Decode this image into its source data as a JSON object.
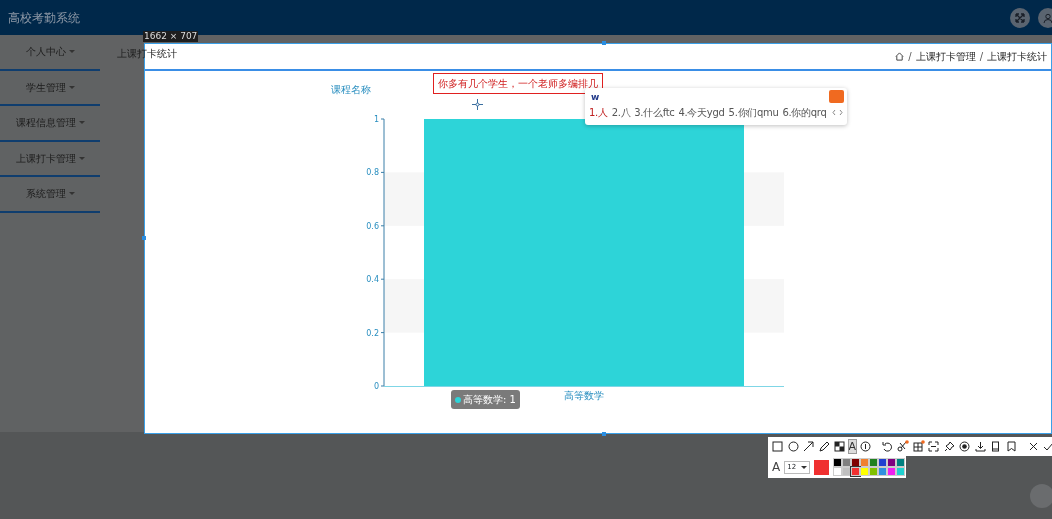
{
  "app": {
    "title": "高校考勤系统"
  },
  "sidebar": {
    "items": [
      {
        "label": "个人中心"
      },
      {
        "label": "学生管理"
      },
      {
        "label": "课程信息管理"
      },
      {
        "label": "上课打卡管理"
      },
      {
        "label": "系统管理"
      }
    ]
  },
  "page": {
    "title": "上课打卡统计",
    "breadcrumb": [
      {
        "kind": "separator",
        "text": "/"
      },
      {
        "kind": "link",
        "text": "上课打卡管理"
      },
      {
        "kind": "separator",
        "text": "/"
      },
      {
        "kind": "current",
        "text": "上课打卡统计"
      }
    ]
  },
  "chart": {
    "title": "课程名称",
    "tooltip": "高等数学: 1",
    "chart_data": {
      "type": "bar",
      "categories": [
        "高等数学"
      ],
      "values": [
        1
      ],
      "ylim": [
        0,
        1
      ],
      "yticks": [
        0,
        0.2,
        0.4,
        0.6,
        0.8,
        1
      ]
    }
  },
  "capture": {
    "size_label": "1662 × 707",
    "annotation": "你多有几个学生，一个老师多编排几",
    "tool_groups": [
      [
        {
          "kind": "rect",
          "selected": false
        },
        {
          "kind": "ellipse",
          "selected": false
        },
        {
          "kind": "arrow",
          "selected": false
        },
        {
          "kind": "pen",
          "selected": false
        },
        {
          "kind": "mosaic",
          "selected": false
        },
        {
          "kind": "text",
          "label": "A",
          "selected": true
        },
        {
          "kind": "number",
          "selected": false
        }
      ],
      [
        {
          "kind": "undo",
          "selected": false
        },
        {
          "kind": "ocr",
          "selected": false
        },
        {
          "kind": "translate",
          "selected": false
        },
        {
          "kind": "scroll",
          "selected": false
        },
        {
          "kind": "pin",
          "selected": false
        },
        {
          "kind": "record",
          "selected": false
        },
        {
          "kind": "save",
          "selected": false
        },
        {
          "kind": "phone",
          "selected": false
        },
        {
          "kind": "bookmark",
          "selected": false
        }
      ],
      [
        {
          "kind": "close",
          "selected": false
        },
        {
          "kind": "check",
          "selected": false
        }
      ]
    ],
    "style_bar": {
      "font_label": "A",
      "font_size": "12",
      "palette": [
        {
          "color": "#000000",
          "selected": false
        },
        {
          "color": "#808080",
          "selected": false
        },
        {
          "color": "#800000",
          "selected": false
        },
        {
          "color": "#f08030",
          "selected": false
        },
        {
          "color": "#208020",
          "selected": false
        },
        {
          "color": "#2040d0",
          "selected": false
        },
        {
          "color": "#800080",
          "selected": false
        },
        {
          "color": "#008080",
          "selected": false
        },
        {
          "color": "#ffffff",
          "selected": false
        },
        {
          "color": "#c0c0c0",
          "selected": false
        },
        {
          "color": "#f03030",
          "selected": true
        },
        {
          "color": "#ffff00",
          "selected": false
        },
        {
          "color": "#80c000",
          "selected": false
        },
        {
          "color": "#3090e0",
          "selected": false
        },
        {
          "color": "#f020f0",
          "selected": false
        },
        {
          "color": "#20d0d0",
          "selected": false
        }
      ]
    }
  },
  "ime": {
    "input": "w",
    "candidates": [
      {
        "text": "1.人",
        "selected": true
      },
      {
        "text": "2.八",
        "selected": false
      },
      {
        "text": "3.什么ftc",
        "selected": false
      },
      {
        "text": "4.今天ygd",
        "selected": false
      },
      {
        "text": "5.你们qmu",
        "selected": false
      },
      {
        "text": "6.你的qrq",
        "selected": false
      }
    ]
  }
}
